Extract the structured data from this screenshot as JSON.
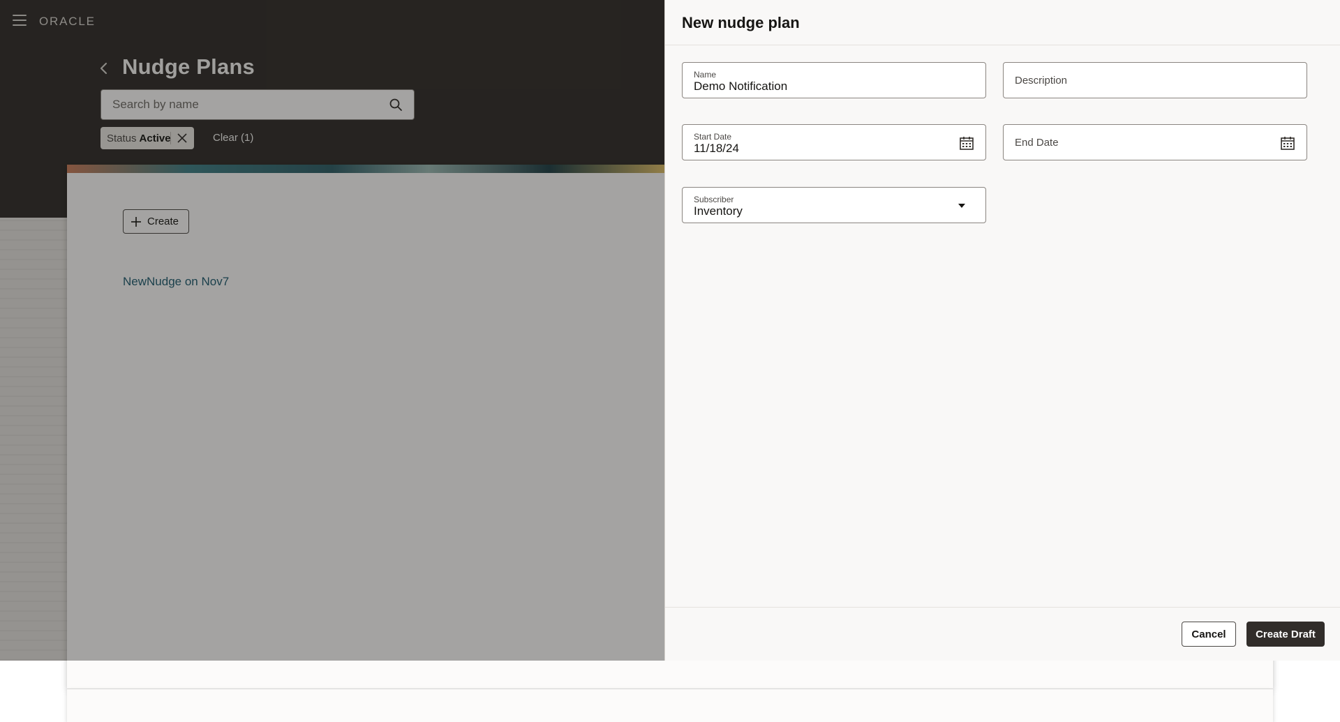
{
  "app": {
    "logo_text": "ORACLE"
  },
  "page": {
    "title": "Nudge Plans",
    "search": {
      "placeholder": "Search by name",
      "value": ""
    },
    "filter_chip": {
      "key": "Status",
      "value": "Active"
    },
    "clear_label": "Clear (1)",
    "create_label": "Create",
    "list_items": [
      "NewNudge on Nov7"
    ]
  },
  "drawer": {
    "title": "New nudge plan",
    "fields": {
      "name": {
        "label": "Name",
        "value": "Demo Notification"
      },
      "description": {
        "label": "Description",
        "value": ""
      },
      "start_date": {
        "label": "Start Date",
        "value": "11/18/24"
      },
      "end_date": {
        "label": "End Date",
        "value": ""
      },
      "subscriber": {
        "label": "Subscriber",
        "value": "Inventory"
      }
    },
    "cancel_label": "Cancel",
    "primary_label": "Create Draft"
  },
  "icons": {
    "menu": "hamburger-menu-icon",
    "back": "chevron-left-icon",
    "search": "search-icon",
    "chip_remove": "close-icon",
    "create": "plus-icon",
    "calendar": "calendar-icon",
    "dropdown": "caret-down-icon"
  },
  "colors": {
    "header_dark": "#312d2a",
    "link": "#1f5b70",
    "primary_button": "#312d2a",
    "drawer_bg": "#f9f8f7"
  }
}
